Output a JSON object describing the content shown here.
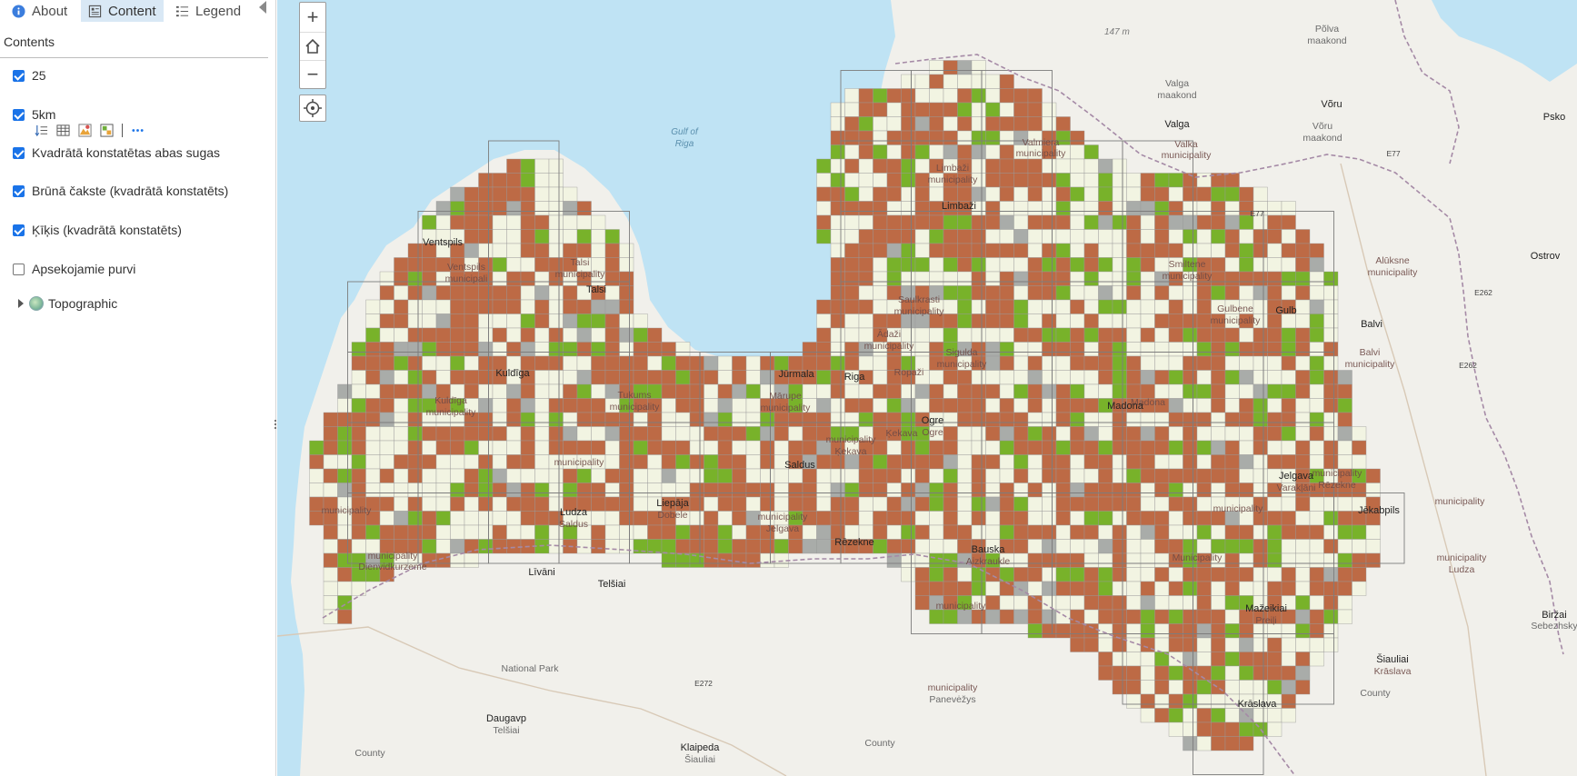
{
  "tabs": {
    "about": "About",
    "content": "Content",
    "legend": "Legend"
  },
  "contents_heading": "Contents",
  "layers": [
    {
      "label": "25",
      "checked": true
    },
    {
      "label": "5km",
      "checked": true
    },
    {
      "label": "Kvadrātā konstatētas abas sugas",
      "checked": true
    },
    {
      "label": "Brūnā čakste (kvadrātā konstatēts)",
      "checked": true
    },
    {
      "label": "Ķīķis (kvadrātā konstatēts)",
      "checked": true
    },
    {
      "label": "Apsekojamie purvi",
      "checked": false
    }
  ],
  "basemap_label": "Topographic",
  "layer_tool_icons": [
    "move-layer-icon",
    "attribute-table-icon",
    "change-style-icon",
    "filter-icon",
    "more-options-icon"
  ],
  "zoom": {
    "in": "+",
    "out": "−"
  },
  "map": {
    "water_label_1": "Gulf of",
    "water_label_2": "Riga",
    "elevation_label": "147 m",
    "colors": {
      "both_species": "#78b22a",
      "brown_shrike": "#bd6a45",
      "surveyed_none": "#f2f4e2",
      "grey_cell": "#a9aca9",
      "water": "#bfe3f4",
      "land": "#f1f0eb"
    },
    "place_labels": [
      {
        "text": "Põlva",
        "kind": "region"
      },
      {
        "text": "maakond",
        "kind": "region"
      },
      {
        "text": "Valga",
        "kind": "region"
      },
      {
        "text": "maakond",
        "kind": "region"
      },
      {
        "text": "Võru",
        "kind": "city"
      },
      {
        "text": "Võru",
        "kind": "region"
      },
      {
        "text": "maakond",
        "kind": "region"
      },
      {
        "text": "Psko",
        "kind": "city"
      },
      {
        "text": "Valga",
        "kind": "city"
      },
      {
        "text": "E77",
        "kind": "road"
      },
      {
        "text": "Valmiera",
        "kind": "municipality"
      },
      {
        "text": "municipality",
        "kind": "municipality"
      },
      {
        "text": "Valka",
        "kind": "municipality"
      },
      {
        "text": "municipality",
        "kind": "municipality"
      },
      {
        "text": "Limbaži",
        "kind": "municipality"
      },
      {
        "text": "municipality",
        "kind": "municipality"
      },
      {
        "text": "Limbaži",
        "kind": "city"
      },
      {
        "text": "E77",
        "kind": "road"
      },
      {
        "text": "Ostrov",
        "kind": "city"
      },
      {
        "text": "Ventspils",
        "kind": "city"
      },
      {
        "text": "Ventspils",
        "kind": "municipality"
      },
      {
        "text": "municipali",
        "kind": "municipality"
      },
      {
        "text": "Talsi",
        "kind": "municipality"
      },
      {
        "text": "municipality",
        "kind": "municipality"
      },
      {
        "text": "Talsi",
        "kind": "city"
      },
      {
        "text": "Smiltene",
        "kind": "municipality"
      },
      {
        "text": "municipality",
        "kind": "municipality"
      },
      {
        "text": "Alūksne",
        "kind": "municipality"
      },
      {
        "text": "municipality",
        "kind": "municipality"
      },
      {
        "text": "Saulkrasti",
        "kind": "municipality"
      },
      {
        "text": "municipality",
        "kind": "municipality"
      },
      {
        "text": "Gulbene",
        "kind": "municipality"
      },
      {
        "text": "municipality",
        "kind": "municipality"
      },
      {
        "text": "Gulb",
        "kind": "city"
      },
      {
        "text": "E262",
        "kind": "road"
      },
      {
        "text": "Balvi",
        "kind": "city"
      },
      {
        "text": "Balvi",
        "kind": "municipality"
      },
      {
        "text": "municipality",
        "kind": "municipality"
      },
      {
        "text": "Ādaži",
        "kind": "municipality"
      },
      {
        "text": "municipality",
        "kind": "municipality"
      },
      {
        "text": "Sigulda",
        "kind": "municipality"
      },
      {
        "text": "municipality",
        "kind": "municipality"
      },
      {
        "text": "Kuldīga",
        "kind": "city"
      },
      {
        "text": "Jūrmala",
        "kind": "city"
      },
      {
        "text": "Riga",
        "kind": "city"
      },
      {
        "text": "Ropaži",
        "kind": "municipality"
      },
      {
        "text": "Ķekava",
        "kind": "municipality"
      },
      {
        "text": "E262",
        "kind": "road"
      },
      {
        "text": "Kuldīga",
        "kind": "municipality"
      },
      {
        "text": "municipality",
        "kind": "municipality"
      },
      {
        "text": "Tukums",
        "kind": "municipality"
      },
      {
        "text": "municipality",
        "kind": "municipality"
      },
      {
        "text": "Mārupe",
        "kind": "municipality"
      },
      {
        "text": "municipality",
        "kind": "municipality"
      },
      {
        "text": "Madona",
        "kind": "municipality"
      },
      {
        "text": "Madona",
        "kind": "city"
      },
      {
        "text": "Krasnogor",
        "kind": "city"
      },
      {
        "text": "Ogre",
        "kind": "city"
      },
      {
        "text": "Ogre",
        "kind": "municipality"
      },
      {
        "text": "municipality",
        "kind": "municipality"
      },
      {
        "text": "Ķekava",
        "kind": "municipality"
      },
      {
        "text": "municipality",
        "kind": "municipality"
      },
      {
        "text": "Rēzekne",
        "kind": "municipality"
      },
      {
        "text": "municipality",
        "kind": "municipality"
      },
      {
        "text": "Saldus",
        "kind": "city"
      },
      {
        "text": "Jelgava",
        "kind": "city"
      },
      {
        "text": "Varakļāni",
        "kind": "municipality"
      },
      {
        "text": "municipality",
        "kind": "municipality"
      },
      {
        "text": "Liepāja",
        "kind": "city"
      },
      {
        "text": "Dobele",
        "kind": "municipality"
      },
      {
        "text": "municipality",
        "kind": "municipality"
      },
      {
        "text": "Ludza",
        "kind": "city"
      },
      {
        "text": "Saldus",
        "kind": "municipality"
      },
      {
        "text": "municipality",
        "kind": "municipality"
      },
      {
        "text": "Jelgava",
        "kind": "municipality"
      },
      {
        "text": "municipality",
        "kind": "municipality"
      },
      {
        "text": "Jēkabpils",
        "kind": "city"
      },
      {
        "text": "Rēzekne",
        "kind": "city"
      },
      {
        "text": "Bauska",
        "kind": "city"
      },
      {
        "text": "Aizkraukle",
        "kind": "municipality"
      },
      {
        "text": "municipality",
        "kind": "municipality"
      },
      {
        "text": "Ludza",
        "kind": "municipality"
      },
      {
        "text": "municipality",
        "kind": "municipality"
      },
      {
        "text": "Dienvidkurzeme",
        "kind": "municipality"
      },
      {
        "text": "Municipality",
        "kind": "municipality"
      },
      {
        "text": "Līvāni",
        "kind": "city"
      },
      {
        "text": "Mažeikiai",
        "kind": "city"
      },
      {
        "text": "Preiļi",
        "kind": "municipality"
      },
      {
        "text": "municipality",
        "kind": "municipality"
      },
      {
        "text": "Biržai",
        "kind": "city"
      },
      {
        "text": "Sebezhsky",
        "kind": "region"
      },
      {
        "text": "National Park",
        "kind": "region"
      },
      {
        "text": "Telšiai",
        "kind": "city"
      },
      {
        "text": "E272",
        "kind": "road"
      },
      {
        "text": "Šiauliai",
        "kind": "city"
      },
      {
        "text": "Krāslava",
        "kind": "municipality"
      },
      {
        "text": "municipality",
        "kind": "municipality"
      },
      {
        "text": "Panevėžys",
        "kind": "region"
      },
      {
        "text": "County",
        "kind": "region"
      },
      {
        "text": "Krāslava",
        "kind": "city"
      },
      {
        "text": "Daugavp",
        "kind": "city"
      },
      {
        "text": "Telšiai",
        "kind": "region"
      },
      {
        "text": "County",
        "kind": "region"
      },
      {
        "text": "Klaipeda",
        "kind": "city"
      },
      {
        "text": "Šiauliai",
        "kind": "region"
      },
      {
        "text": "County",
        "kind": "region"
      },
      {
        "text": "Panevezys",
        "kind": "city"
      }
    ]
  }
}
